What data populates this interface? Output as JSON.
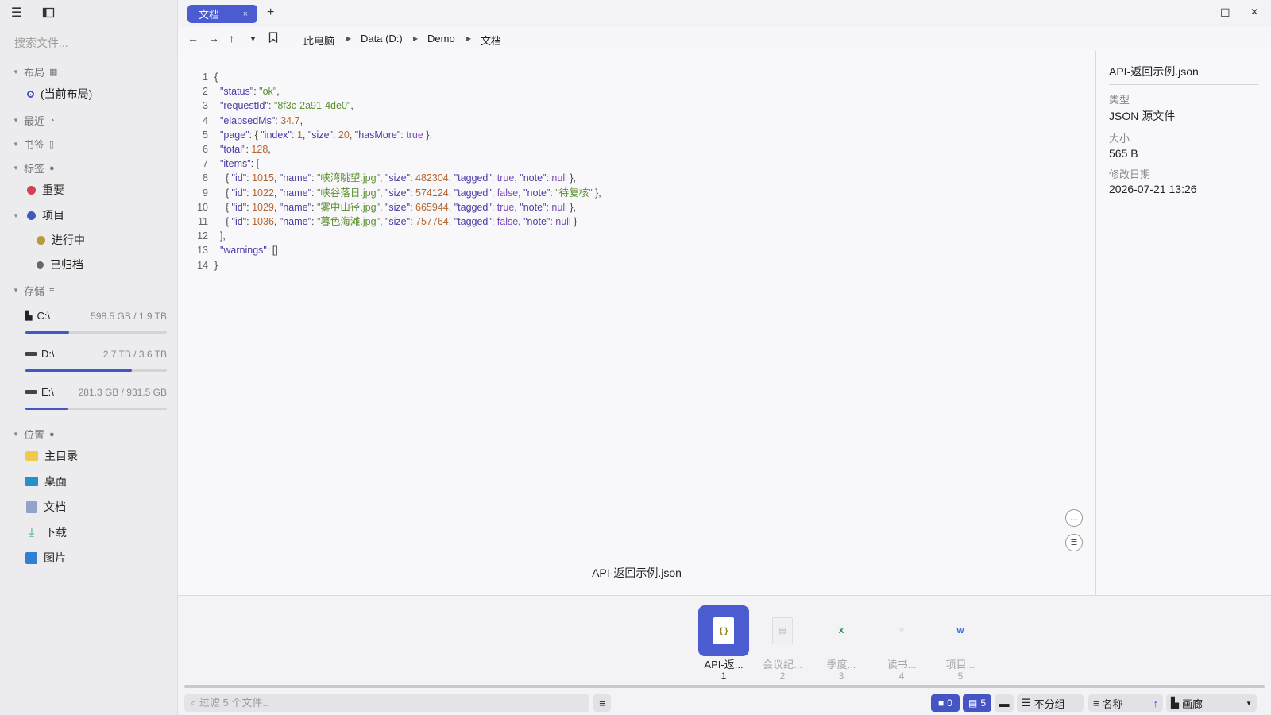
{
  "sidebar": {
    "search_placeholder": "搜索文件...",
    "sections": {
      "layout": "布局",
      "recent": "最近",
      "bookmarks": "书签",
      "tags": "标签",
      "storage": "存储",
      "locations": "位置"
    },
    "current_layout": "(当前布局)",
    "tags": [
      {
        "label": "重要",
        "color": "#cc4455"
      },
      {
        "label": "项目",
        "color": "#3d5bb8"
      },
      {
        "label": "进行中",
        "color": "#b89a3a"
      },
      {
        "label": "已归档",
        "color": "#66666c"
      }
    ],
    "drives": [
      {
        "name": "C:\\",
        "size": "598.5 GB / 1.9 TB",
        "used_fraction": 0.31
      },
      {
        "name": "D:\\",
        "size": "2.7 TB / 3.6 TB",
        "used_fraction": 0.75
      },
      {
        "name": "E:\\",
        "size": "281.3 GB / 931.5 GB",
        "used_fraction": 0.3
      }
    ],
    "locations": [
      {
        "label": "主目录",
        "icon": "folder-icon"
      },
      {
        "label": "桌面",
        "icon": "desktop-icon"
      },
      {
        "label": "文档",
        "icon": "documents-icon"
      },
      {
        "label": "下载",
        "icon": "download-icon"
      },
      {
        "label": "图片",
        "icon": "pictures-icon"
      }
    ]
  },
  "tabs": {
    "active_label": "文档",
    "close_glyph": "×",
    "new_tab_glyph": "+"
  },
  "breadcrumb": [
    "此电脑",
    "Data (D:)",
    "Demo",
    "文档"
  ],
  "preview": {
    "filename": "API-返回示例.json",
    "line_numbers": [
      "1",
      "2",
      "3",
      "4",
      "5",
      "6",
      "7",
      "8",
      "9",
      "10",
      "11",
      "12",
      "13",
      "14"
    ]
  },
  "info": {
    "title": "API-返回示例.json",
    "type_label": "类型",
    "type_value": "JSON 源文件",
    "size_label": "大小",
    "size_value": "565 B",
    "modified_label": "修改日期",
    "modified_value": "2026-07-21 13:26"
  },
  "filmstrip": [
    {
      "name": "API-返...",
      "num": "1",
      "active": true
    },
    {
      "name": "会议纪...",
      "num": "2",
      "active": false
    },
    {
      "name": "季度...",
      "num": "3",
      "active": false
    },
    {
      "name": "读书...",
      "num": "4",
      "active": false
    },
    {
      "name": "项目...",
      "num": "5",
      "active": false
    }
  ],
  "statusbar": {
    "filter_placeholder": "过滤 5 个文件..",
    "folder_count": "0",
    "file_count": "5",
    "group_label": "不分组",
    "sort_label": "名称",
    "view_label": "画廊"
  },
  "colors": {
    "accent": "#4b5bd0",
    "json_key": "#4c3aa6",
    "json_string": "#5a8e2e",
    "json_number": "#b7642a",
    "json_boolean": "#7a47b5"
  }
}
